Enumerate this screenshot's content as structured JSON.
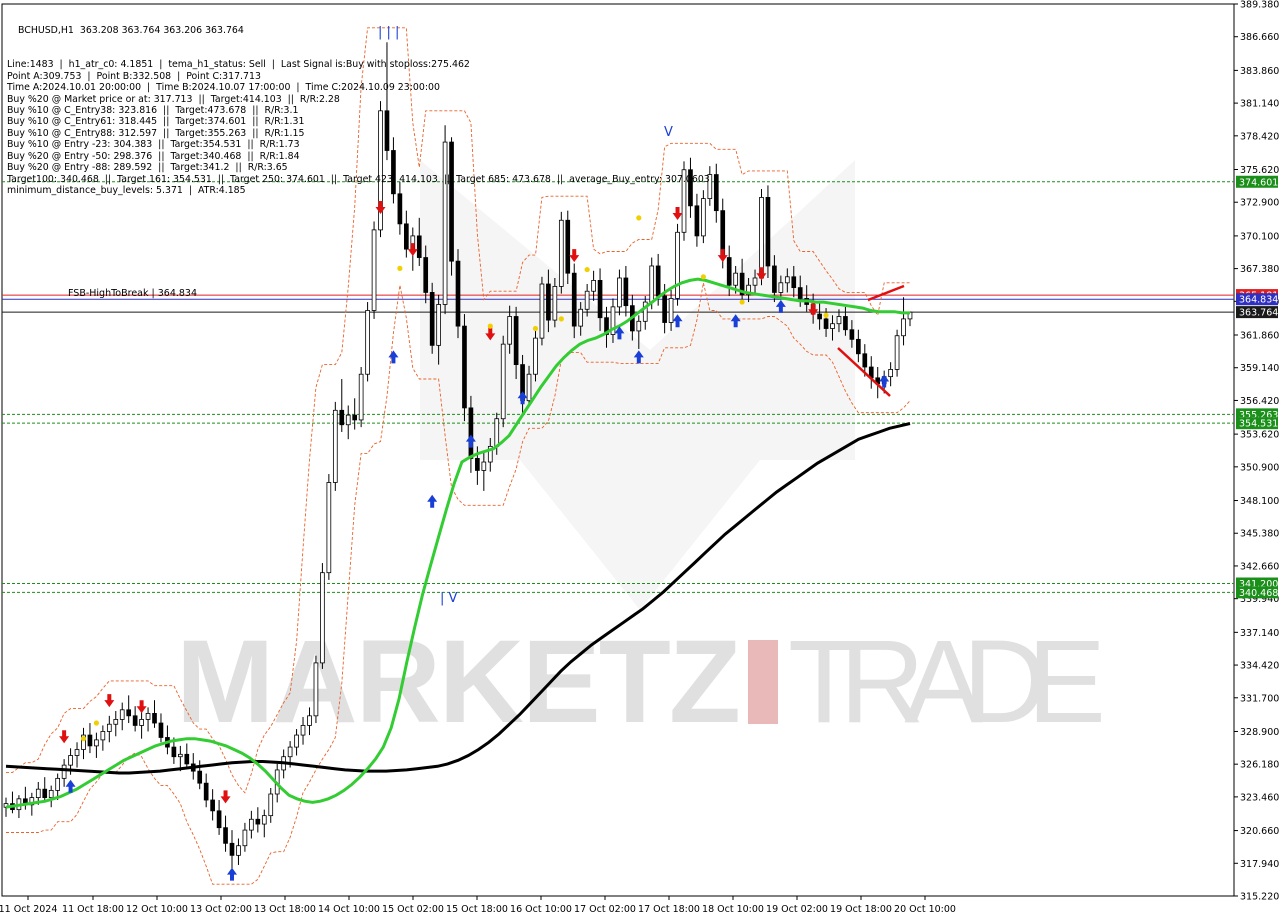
{
  "header": {
    "symbol_line": "BCHUSD,H1  363.208 363.764 363.206 363.764",
    "info_lines": [
      "Line:1483  |  h1_atr_c0: 4.1851  |  tema_h1_status: Sell  |  Last Signal is:Buy with stoploss:275.462",
      "Point A:309.753  |  Point B:332.508  |  Point C:317.713",
      "Time A:2024.10.01 20:00:00  |  Time B:2024.10.07 17:00:00  |  Time C:2024.10.09 23:00:00",
      "Buy %20 @ Market price or at: 317.713  ||  Target:414.103  ||  R/R:2.28",
      "Buy %10 @ C_Entry38: 323.816  ||  Target:473.678  ||  R/R:3.1",
      "Buy %10 @ C_Entry61: 318.445  ||  Target:374.601  ||  R/R:1.31",
      "Buy %10 @ C_Entry88: 312.597  ||  Target:355.263  ||  R/R:1.15",
      "Buy %10 @ Entry -23: 304.383  ||  Target:354.531  ||  R/R:1.73",
      "Buy %20 @ Entry -50: 298.376  ||  Target:340.468  ||  R/R:1.84",
      "Buy %20 @ Entry -88: 289.592  ||  Target:341.2  ||  R/R:3.65",
      "Target100: 340.468  ||  Target 161: 354.531  ||  Target 250: 374.601  ||  Target 423: 414.103  ||  Target 685: 473.678  ||  average_Buy_entry: 307.0603",
      "minimum_distance_buy_levels: 5.371  |  ATR:4.185"
    ]
  },
  "chart_data": {
    "type": "candlestick",
    "symbol": "BCHUSD",
    "timeframe": "H1",
    "ylim": [
      315.22,
      389.38
    ],
    "y_ticks": [
      389.38,
      386.66,
      383.86,
      381.14,
      378.42,
      375.62,
      372.9,
      370.1,
      367.38,
      364.66,
      361.86,
      359.14,
      356.42,
      353.62,
      350.9,
      348.1,
      345.38,
      342.66,
      339.94,
      337.14,
      334.42,
      331.7,
      328.9,
      326.18,
      323.46,
      320.66,
      317.94,
      315.22
    ],
    "x_labels": [
      "11 Oct 2024",
      "11 Oct 18:00",
      "12 Oct 10:00",
      "13 Oct 02:00",
      "13 Oct 18:00",
      "14 Oct 10:00",
      "15 Oct 02:00",
      "15 Oct 18:00",
      "16 Oct 10:00",
      "17 Oct 02:00",
      "17 Oct 18:00",
      "18 Oct 10:00",
      "19 Oct 02:00",
      "19 Oct 18:00",
      "20 Oct 10:00"
    ],
    "candles_ohlc": [
      [
        322.6,
        323.4,
        321.8,
        322.9
      ],
      [
        322.9,
        323.9,
        322.1,
        322.4
      ],
      [
        322.4,
        323.6,
        321.7,
        323.3
      ],
      [
        323.3,
        324.3,
        322.4,
        322.8
      ],
      [
        322.8,
        323.8,
        321.9,
        323.4
      ],
      [
        323.4,
        324.7,
        322.8,
        324.1
      ],
      [
        324.1,
        325.1,
        323.1,
        323.4
      ],
      [
        323.4,
        324.4,
        322.6,
        324.0
      ],
      [
        324.0,
        325.4,
        323.2,
        325.0
      ],
      [
        325.0,
        326.6,
        324.3,
        326.1
      ],
      [
        326.1,
        327.5,
        325.3,
        326.9
      ],
      [
        326.9,
        328.0,
        325.9,
        327.4
      ],
      [
        327.4,
        329.2,
        326.6,
        328.6
      ],
      [
        328.6,
        329.6,
        327.1,
        327.7
      ],
      [
        327.7,
        328.8,
        326.7,
        328.2
      ],
      [
        328.2,
        329.4,
        327.3,
        328.9
      ],
      [
        328.9,
        330.2,
        328.0,
        329.5
      ],
      [
        329.5,
        330.6,
        328.5,
        329.9
      ],
      [
        329.9,
        331.3,
        329.0,
        330.7
      ],
      [
        330.7,
        331.9,
        329.6,
        330.2
      ],
      [
        330.2,
        331.0,
        328.9,
        329.4
      ],
      [
        329.4,
        330.6,
        328.3,
        329.9
      ],
      [
        329.9,
        330.9,
        328.9,
        330.4
      ],
      [
        330.4,
        331.5,
        329.2,
        329.6
      ],
      [
        329.6,
        330.4,
        328.0,
        328.4
      ],
      [
        328.4,
        329.4,
        327.0,
        327.6
      ],
      [
        327.6,
        328.4,
        326.2,
        326.8
      ],
      [
        326.8,
        327.7,
        325.6,
        327.0
      ],
      [
        327.0,
        327.9,
        325.8,
        326.2
      ],
      [
        326.2,
        327.1,
        324.9,
        325.6
      ],
      [
        325.6,
        326.5,
        324.1,
        324.6
      ],
      [
        324.6,
        325.4,
        322.6,
        323.2
      ],
      [
        323.2,
        324.1,
        321.5,
        322.3
      ],
      [
        322.3,
        323.2,
        320.3,
        320.9
      ],
      [
        320.9,
        321.9,
        318.9,
        319.6
      ],
      [
        319.6,
        320.7,
        317.4,
        318.6
      ],
      [
        318.6,
        320.0,
        317.8,
        319.4
      ],
      [
        319.4,
        321.3,
        318.9,
        320.7
      ],
      [
        320.7,
        322.3,
        320.0,
        321.6
      ],
      [
        321.6,
        322.6,
        320.5,
        321.2
      ],
      [
        321.2,
        322.4,
        320.1,
        321.9
      ],
      [
        321.9,
        324.2,
        321.3,
        323.7
      ],
      [
        323.7,
        326.2,
        323.0,
        325.7
      ],
      [
        325.7,
        327.4,
        325.0,
        326.8
      ],
      [
        326.8,
        328.1,
        325.9,
        327.6
      ],
      [
        327.6,
        329.1,
        326.9,
        328.6
      ],
      [
        328.6,
        330.1,
        327.8,
        329.4
      ],
      [
        329.4,
        330.9,
        328.6,
        330.2
      ],
      [
        330.2,
        335.2,
        329.6,
        334.6
      ],
      [
        334.6,
        342.9,
        334.1,
        342.1
      ],
      [
        342.1,
        350.3,
        341.5,
        349.6
      ],
      [
        349.6,
        356.3,
        348.9,
        355.6
      ],
      [
        355.6,
        358.2,
        353.8,
        354.4
      ],
      [
        354.4,
        356.0,
        353.2,
        355.2
      ],
      [
        355.2,
        356.6,
        354.0,
        354.8
      ],
      [
        354.8,
        359.2,
        354.2,
        358.6
      ],
      [
        358.6,
        364.6,
        358.0,
        363.9
      ],
      [
        363.9,
        371.3,
        363.2,
        370.6
      ],
      [
        370.6,
        381.3,
        370.0,
        380.5
      ],
      [
        380.5,
        386.2,
        376.4,
        377.2
      ],
      [
        377.2,
        378.3,
        372.8,
        373.6
      ],
      [
        373.6,
        374.6,
        370.2,
        371.1
      ],
      [
        371.1,
        372.2,
        368.3,
        369.0
      ],
      [
        369.0,
        370.8,
        367.2,
        370.1
      ],
      [
        370.1,
        371.6,
        367.6,
        368.3
      ],
      [
        368.3,
        369.3,
        364.5,
        365.4
      ],
      [
        365.4,
        366.2,
        360.3,
        361.0
      ],
      [
        361.0,
        365.2,
        359.4,
        364.4
      ],
      [
        364.4,
        379.3,
        363.6,
        377.9
      ],
      [
        377.9,
        378.3,
        366.8,
        368.0
      ],
      [
        368.0,
        369.0,
        361.6,
        362.6
      ],
      [
        362.6,
        363.6,
        354.7,
        355.8
      ],
      [
        355.8,
        356.8,
        350.4,
        351.6
      ],
      [
        351.6,
        352.6,
        349.4,
        350.6
      ],
      [
        350.6,
        352.1,
        348.9,
        351.3
      ],
      [
        351.3,
        353.3,
        350.5,
        352.6
      ],
      [
        352.6,
        355.4,
        351.9,
        354.9
      ],
      [
        354.9,
        361.8,
        354.2,
        361.1
      ],
      [
        361.1,
        364.3,
        360.3,
        363.4
      ],
      [
        363.4,
        364.2,
        358.2,
        359.4
      ],
      [
        359.4,
        360.2,
        355.3,
        356.4
      ],
      [
        356.4,
        359.3,
        355.9,
        358.6
      ],
      [
        358.6,
        362.2,
        358.0,
        361.6
      ],
      [
        361.6,
        366.7,
        361.0,
        366.1
      ],
      [
        366.1,
        367.3,
        362.1,
        363.1
      ],
      [
        363.1,
        366.6,
        362.5,
        365.9
      ],
      [
        365.9,
        372.1,
        365.3,
        371.4
      ],
      [
        371.4,
        372.2,
        366.1,
        367.0
      ],
      [
        367.0,
        367.8,
        361.6,
        362.6
      ],
      [
        362.6,
        364.6,
        361.8,
        364.0
      ],
      [
        364.0,
        366.1,
        363.4,
        365.5
      ],
      [
        365.5,
        367.2,
        364.7,
        366.4
      ],
      [
        366.4,
        367.4,
        362.2,
        363.3
      ],
      [
        363.3,
        364.2,
        360.8,
        361.9
      ],
      [
        361.9,
        364.9,
        361.2,
        364.2
      ],
      [
        364.2,
        367.3,
        363.5,
        366.6
      ],
      [
        366.6,
        367.6,
        363.4,
        364.3
      ],
      [
        364.3,
        365.2,
        361.4,
        362.2
      ],
      [
        362.2,
        363.5,
        360.7,
        363.0
      ],
      [
        363.0,
        365.1,
        362.3,
        364.6
      ],
      [
        364.6,
        368.3,
        364.0,
        367.6
      ],
      [
        367.6,
        368.6,
        364.3,
        365.1
      ],
      [
        365.1,
        366.1,
        362.0,
        362.9
      ],
      [
        362.9,
        365.6,
        362.2,
        364.9
      ],
      [
        364.9,
        371.1,
        364.3,
        370.4
      ],
      [
        370.4,
        376.3,
        369.7,
        375.6
      ],
      [
        375.6,
        376.6,
        371.6,
        372.6
      ],
      [
        372.6,
        373.6,
        369.2,
        370.1
      ],
      [
        370.1,
        373.9,
        369.5,
        373.2
      ],
      [
        373.2,
        375.9,
        372.6,
        375.2
      ],
      [
        375.2,
        376.1,
        371.2,
        372.2
      ],
      [
        372.2,
        373.2,
        367.4,
        368.3
      ],
      [
        368.3,
        369.3,
        365.1,
        366.0
      ],
      [
        366.0,
        367.6,
        365.3,
        367.0
      ],
      [
        367.0,
        368.2,
        364.4,
        365.2
      ],
      [
        365.2,
        366.6,
        364.6,
        366.0
      ],
      [
        366.0,
        367.3,
        365.2,
        366.6
      ],
      [
        366.6,
        374.0,
        366.0,
        373.3
      ],
      [
        373.3,
        374.3,
        366.6,
        367.6
      ],
      [
        367.6,
        368.5,
        364.6,
        365.4
      ],
      [
        365.4,
        366.8,
        364.8,
        366.2
      ],
      [
        366.2,
        367.4,
        365.4,
        366.7
      ],
      [
        366.7,
        367.6,
        365.0,
        365.8
      ],
      [
        365.8,
        366.8,
        364.2,
        364.9
      ],
      [
        364.9,
        366.0,
        363.8,
        364.4
      ],
      [
        364.4,
        365.3,
        362.8,
        363.6
      ],
      [
        363.6,
        364.5,
        362.3,
        363.2
      ],
      [
        363.2,
        364.1,
        361.7,
        362.4
      ],
      [
        362.4,
        363.5,
        361.4,
        362.8
      ],
      [
        362.8,
        364.0,
        362.1,
        363.4
      ],
      [
        363.4,
        364.2,
        361.8,
        362.3
      ],
      [
        362.3,
        363.1,
        360.8,
        361.5
      ],
      [
        361.5,
        362.3,
        359.6,
        360.3
      ],
      [
        360.3,
        361.1,
        358.4,
        359.2
      ],
      [
        359.2,
        360.1,
        357.4,
        358.3
      ],
      [
        358.3,
        359.2,
        356.6,
        357.8
      ],
      [
        357.8,
        358.9,
        357.0,
        358.4
      ],
      [
        358.4,
        359.6,
        357.6,
        359.0
      ],
      [
        359.0,
        362.3,
        358.4,
        361.8
      ],
      [
        361.8,
        365.0,
        361.0,
        363.2
      ],
      [
        363.2,
        363.8,
        362.6,
        363.76
      ]
    ],
    "ema_green": [
      322.6,
      322.7,
      322.8,
      322.9,
      323.0,
      323.1,
      323.3,
      323.5,
      323.8,
      324.1,
      324.5,
      324.9,
      325.3,
      325.7,
      326.1,
      326.5,
      326.8,
      327.1,
      327.4,
      327.7,
      327.9,
      328.1,
      328.2,
      328.3,
      328.3,
      328.2,
      328.1,
      327.9,
      327.7,
      327.4,
      327.1,
      326.7,
      326.2,
      325.6,
      324.9,
      324.2,
      323.6,
      323.3,
      323.1,
      323.0,
      323.1,
      323.3,
      323.6,
      324.0,
      324.5,
      325.1,
      325.8,
      326.6,
      327.6,
      329.2,
      331.6,
      334.7,
      337.6,
      340.3,
      342.7,
      345.0,
      347.3,
      349.5,
      351.3,
      351.7,
      352.0,
      352.2,
      352.4,
      352.9,
      353.5,
      354.5,
      355.5,
      356.5,
      357.5,
      358.4,
      359.3,
      360.0,
      360.6,
      361.1,
      361.4,
      361.6,
      361.9,
      362.3,
      362.6,
      363.0,
      363.5,
      364.0,
      364.5,
      365.0,
      365.5,
      365.9,
      366.2,
      366.4,
      366.5,
      366.4,
      366.2,
      366.0,
      365.8,
      365.6,
      365.4,
      365.3,
      365.2,
      365.1,
      365.0,
      364.9,
      364.8,
      364.7,
      364.7,
      364.6,
      364.6,
      364.5,
      364.4,
      364.3,
      364.2,
      364.1,
      363.9,
      363.8,
      363.8,
      363.8,
      363.7,
      363.7
    ],
    "sma_black": [
      326.0,
      325.95,
      325.9,
      325.85,
      325.8,
      325.75,
      325.7,
      325.65,
      325.6,
      325.55,
      325.5,
      325.45,
      325.45,
      325.5,
      325.55,
      325.6,
      325.7,
      325.8,
      325.9,
      326.0,
      326.1,
      326.2,
      326.3,
      326.35,
      326.4,
      326.4,
      326.35,
      326.3,
      326.2,
      326.1,
      326.0,
      325.9,
      325.8,
      325.7,
      325.65,
      325.6,
      325.6,
      325.6,
      325.65,
      325.7,
      325.8,
      325.9,
      326.0,
      326.2,
      326.5,
      326.9,
      327.4,
      328.0,
      328.7,
      329.5,
      330.3,
      331.2,
      332.1,
      333.0,
      333.9,
      334.7,
      335.4,
      336.1,
      336.7,
      337.3,
      337.9,
      338.5,
      339.1,
      339.8,
      340.5,
      341.3,
      342.1,
      342.9,
      343.7,
      344.5,
      345.3,
      346.0,
      346.7,
      347.4,
      348.1,
      348.8,
      349.4,
      350.0,
      350.6,
      351.2,
      351.7,
      352.2,
      352.7,
      353.2,
      353.5,
      353.8,
      354.1,
      354.3,
      354.5
    ]
  },
  "levels": [
    {
      "name": "target-374",
      "label": "374.601",
      "value": 374.601,
      "color": "#1a8f1a"
    },
    {
      "name": "fsb-high",
      "label": "365.181",
      "value": 365.181,
      "color": "#e02020"
    },
    {
      "name": "line-364-8",
      "label": "364.834",
      "value": 364.834,
      "color": "#3030c0"
    },
    {
      "name": "current-price",
      "label": "363.764",
      "value": 363.764,
      "color": "#1a1a1a"
    },
    {
      "name": "target-355",
      "label": "355.263",
      "value": 355.263,
      "color": "#1a8f1a"
    },
    {
      "name": "target-354",
      "label": "354.531",
      "value": 354.531,
      "color": "#1a8f1a"
    },
    {
      "name": "target-341",
      "label": "341.200",
      "value": 341.2,
      "color": "#1a8f1a"
    },
    {
      "name": "target-340",
      "label": "340.468",
      "value": 340.468,
      "color": "#1a8f1a"
    }
  ],
  "fsb_label": "FSB-HighToBreak | 364.834",
  "watermark": {
    "part1": "MARKETZ",
    "part2": "TRADE",
    "bar_color": "#e2a0a0"
  },
  "colors": {
    "green_line": "#33cc33",
    "black_line": "#000000",
    "buy_arrow": "#1a3fd6",
    "sell_arrow": "#e01010",
    "star": "#f0d000",
    "fractal": "#e8622a"
  },
  "wave_labels": {
    "top": "| | |",
    "mid": "V",
    "low": "| V"
  }
}
